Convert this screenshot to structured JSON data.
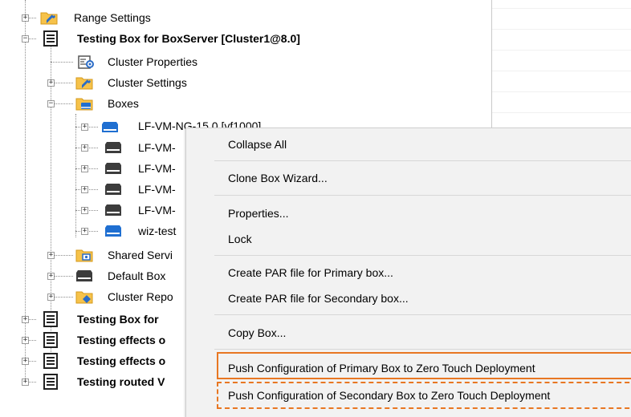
{
  "tree": {
    "nodes": [
      {
        "label": "Range Settings",
        "icon": "folder-wrench-icon"
      },
      {
        "label": "Testing Box for BoxServer [Cluster1@8.0]",
        "icon": "server-icon"
      },
      {
        "label": "Cluster Properties",
        "icon": "cluster-properties-icon"
      },
      {
        "label": "Cluster Settings",
        "icon": "folder-wrench-icon"
      },
      {
        "label": "Boxes",
        "icon": "folder-box-icon"
      },
      {
        "label": "LF-VM-NG-15.0 [vf1000]",
        "icon": "box-blue-icon"
      },
      {
        "label": "LF-VM-",
        "icon": "box-dark-icon"
      },
      {
        "label": "LF-VM-",
        "icon": "box-dark-icon"
      },
      {
        "label": "LF-VM-",
        "icon": "box-dark-icon"
      },
      {
        "label": "LF-VM-",
        "icon": "box-dark-icon"
      },
      {
        "label": "wiz-test",
        "icon": "box-blue-icon"
      },
      {
        "label": "Shared Servi",
        "icon": "folder-service-icon"
      },
      {
        "label": "Default Box",
        "icon": "box-dark-icon"
      },
      {
        "label": "Cluster Repo",
        "icon": "folder-repo-icon"
      },
      {
        "label": "Testing Box for",
        "icon": "server-icon"
      },
      {
        "label": "Testing effects o",
        "icon": "server-icon"
      },
      {
        "label": "Testing effects o",
        "icon": "server-icon"
      },
      {
        "label": "Testing routed V",
        "icon": "server-icon"
      }
    ]
  },
  "context_menu": {
    "collapse_all": "Collapse All",
    "clone_box_wizard": "Clone Box Wizard...",
    "properties": "Properties...",
    "lock": "Lock",
    "create_par_primary": "Create PAR file for Primary box...",
    "create_par_secondary": "Create PAR file for Secondary box...",
    "copy_box": "Copy Box...",
    "push_primary": "Push Configuration of Primary Box to Zero Touch Deployment",
    "push_secondary": "Push Configuration of Secondary Box to Zero Touch Deployment"
  },
  "colors": {
    "highlight": "#e87722",
    "menu_bg": "#f2f2f2",
    "folder": "#f6c24a",
    "box_blue": "#1f6fd1",
    "box_dark": "#3c3c3c"
  }
}
